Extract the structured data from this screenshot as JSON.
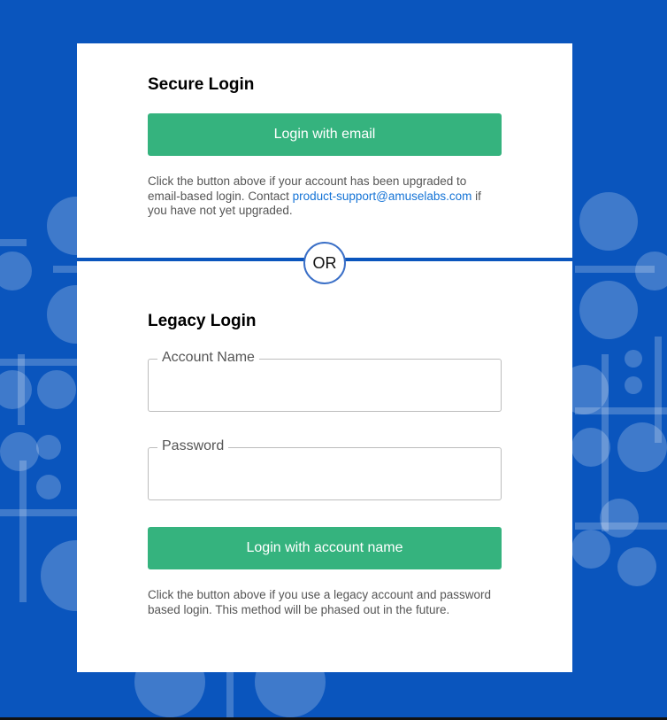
{
  "secure": {
    "heading": "Secure Login",
    "button_label": "Login with email",
    "note_before": "Click the button above if your account has been upgraded to email-based login. Contact ",
    "support_email": "product-support@amuselabs.com",
    "note_after": " if you have not yet upgraded."
  },
  "divider": {
    "label": "OR"
  },
  "legacy": {
    "heading": "Legacy Login",
    "account_label": "Account Name",
    "account_value": "",
    "password_label": "Password",
    "password_value": "",
    "button_label": "Login with account name",
    "note": "Click the button above if you use a legacy account and password based login. This method will be phased out in the future."
  },
  "colors": {
    "background": "#0a55bd",
    "button": "#35b37e",
    "link": "#1473d6",
    "card": "#ffffff"
  }
}
